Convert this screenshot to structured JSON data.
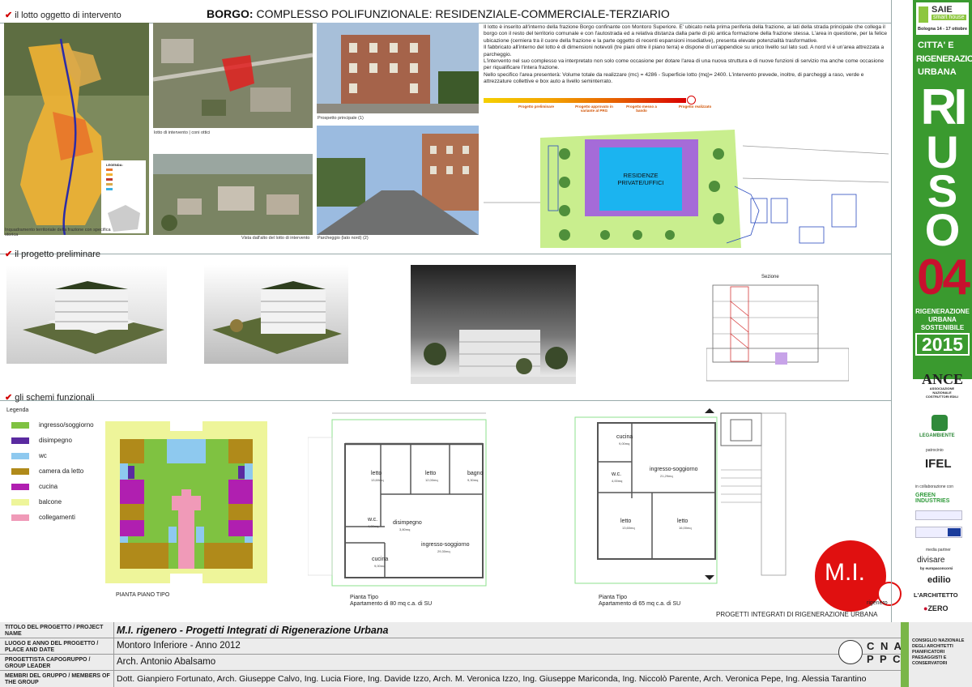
{
  "header": {
    "section1": "il lotto oggetto di intervento",
    "title_bold": "BORGO:",
    "title_rest": " COMPLESSO POLIFUNZIONALE: RESIDENZIALE-COMMERCIALE-TERZIARIO"
  },
  "captions": {
    "map": "Inquadramento territoriale della frazione con specifica storica",
    "ortho": "lotto di intervento | coni ottici",
    "aerial": "Vista dall'alto del lotto di intervento",
    "prospetto": "Prospetto principale (1)",
    "parcheggio": "Parcheggio (lato nord) (2)",
    "map_legend": "LEGENDA:"
  },
  "description": [
    "Il lotto è inserito all'interno della frazione Borgo confinante con Montoro Superiore. E' ubicato nella prima periferia della frazione, ai lati della strada principale che collega il borgo con il resto del territorio comunale e con l'autostrada ed a relativa distanza dalla parte di più antica formazione della frazione stessa. L'area in questione, per la felice ubicazione (cerniera tra il cuore della frazione e la parte oggetto di recenti espansioni insediative), presenta elevate potenzialità trasformative.",
    "Il fabbricato all'interno del lotto è di dimensioni notevoli (tre piani oltre il piano terra) e dispone di un'appendice su unico livello sul lato sud. A nord vi è un'area attrezzata a parcheggio.",
    "L'intervento nel suo complesso va interpretato non solo come occasione per dotare l'area di una nuova struttura e di nuove funzioni di servizio ma anche come occasione per riqualificare l'intera frazione.",
    "Nello specifico l'area presenterà: Volume totale da realizzare (mc) = 4286 - Superficie lotto (mq)= 2400. L'intervento prevede, inoltre, di parcheggi a raso, verde e attrezzature collettive e box auto a livello seminterrato."
  ],
  "timeline": [
    "Progetto preliminare",
    "Progetto approvato in variante al PRG",
    "Progetto messo a bando",
    "Progetto realizzato"
  ],
  "site_plan_label": "RESIDENZE PRIVATE/UFFICI",
  "section2": "il progetto preliminare",
  "sezione_label": "Sezione",
  "section3": "gli schemi funzionali",
  "legend": {
    "title": "Legenda",
    "items": [
      {
        "label": "ingresso/soggiorno",
        "color": "#7fc241"
      },
      {
        "label": "disimpegno",
        "color": "#5a2aa0"
      },
      {
        "label": "wc",
        "color": "#8ec9ef"
      },
      {
        "label": "camera da letto",
        "color": "#b08a1a"
      },
      {
        "label": "cucina",
        "color": "#b01fb0"
      },
      {
        "label": "balcone",
        "color": "#eef59a"
      },
      {
        "label": "collegamenti",
        "color": "#f09ab8"
      }
    ]
  },
  "plans": {
    "typical_caption": "PIANTA PIANO TIPO",
    "plan1_caption_1": "Pianta Tipo",
    "plan1_caption_2": "Apartamento di 80 mq c.a. di SU",
    "plan2_caption_1": "Pianta Tipo",
    "plan2_caption_2": "Apartamento di 65 mq c.a. di SU",
    "plan1_rooms": [
      "letto",
      "letto",
      "bagno",
      "disimpegno",
      "w.c.",
      "ingresso-soggiorno",
      "cucina"
    ],
    "plan1_areas": [
      "13,60mq",
      "12,00mq",
      "9,30mq",
      "3,80mq",
      "4,00mq",
      "29,30mq",
      "9,00mq"
    ],
    "plan2_rooms": [
      "cucina",
      "w.c.",
      "ingresso-soggiorno",
      "letto",
      "letto"
    ],
    "plan2_areas": [
      "9,00mq",
      "4,00mq",
      "21,29mq",
      "13,60mq",
      "16,00mq"
    ]
  },
  "logo": {
    "mi": "M.I.",
    "rigenero": "rigenero"
  },
  "bottom_note": "PROGETTI INTEGRATI DI RIGENERAZIONE URBANA",
  "sidebar": {
    "saie": "SAIE",
    "smart": "smart house",
    "dates": "Bologna 14 - 17 ottobre",
    "citta": "CITTA' E",
    "rigenerazione": "RIGENERAZIONE",
    "urbana": "URBANA",
    "letters": [
      "RI",
      "U",
      "S",
      "O"
    ],
    "number": "04",
    "sub1": "RIGENERAZIONE",
    "sub2": "URBANA",
    "sub3": "SOSTENIBILE",
    "year": "2015",
    "ance": "ANCE",
    "ance_sub": "ASSOCIAZIONE NAZIONALE COSTRUTTORI EDILI",
    "legambiente": "LEGAMBIENTE",
    "patrocinio": "patrocinio",
    "ifel": "IFEL",
    "collab": "in collaborazione con",
    "green": "GREEN INDUSTRIES",
    "media": "media partner",
    "divisare": "divisare",
    "europaconcorsi": "by europaconcorsi",
    "edilio": "edilio",
    "architetto": "L'ARCHITETTO",
    "zero": "ZERO"
  },
  "footer": {
    "rows": [
      {
        "label": "TITOLO DEL PROGETTO / PROJECT NAME",
        "value": "M.I. rigenero - Progetti Integrati di Rigenerazione Urbana"
      },
      {
        "label": "LUOGO E ANNO DEL PROGETTO / PLACE AND DATE",
        "value": "Montoro Inferiore - Anno 2012"
      },
      {
        "label": "PROGETTISTA CAPOGRUPPO / GROUP LEADER",
        "value": "Arch. Antonio Abalsamo"
      },
      {
        "label": "MEMBRI DEL GRUPPO / MEMBERS OF THE GROUP",
        "value": "Dott. Gianpiero Fortunato, Arch. Giuseppe Calvo, Ing. Lucia Fiore, Ing. Davide Izzo, Arch. M. Veronica Izzo, Ing. Giuseppe Mariconda, Ing. Niccolò Parente, Arch. Veronica Pepe, Ing. Alessia Tarantino"
      }
    ],
    "cnappc_1": "C N A",
    "cnappc_2": "P P C",
    "council": "CONSIGLIO NAZIONALE DEGLI ARCHITETTI PIANIFICATORI PAESAGGISTI E CONSERVATORI"
  }
}
